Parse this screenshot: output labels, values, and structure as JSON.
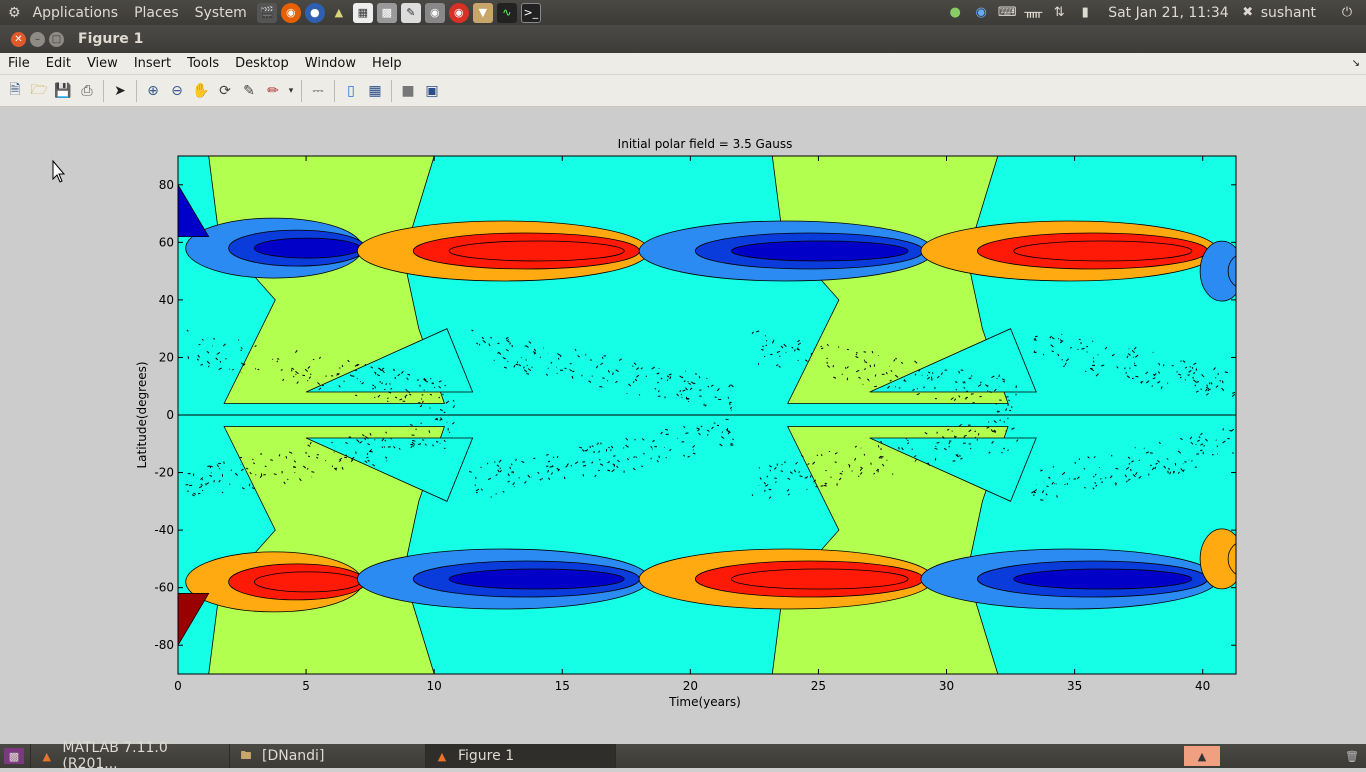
{
  "top_panel": {
    "menus": [
      "Applications",
      "Places",
      "System"
    ],
    "clock": "Sat Jan 21, 11:34",
    "user": "sushant"
  },
  "window": {
    "title": "Figure 1"
  },
  "menubar": {
    "items": [
      "File",
      "Edit",
      "View",
      "Insert",
      "Tools",
      "Desktop",
      "Window",
      "Help"
    ]
  },
  "taskbar": {
    "tasks": [
      {
        "label": "MATLAB  7.11.0 (R201..."
      },
      {
        "label": "[DNandi]"
      },
      {
        "label": "Figure 1"
      }
    ]
  },
  "chart_data": {
    "type": "heatmap",
    "title": "Initial polar field = 3.5 Gauss",
    "xlabel": "Time(years)",
    "ylabel": "Latitude(degrees)",
    "xlim": [
      0,
      41.3
    ],
    "ylim": [
      -90,
      90
    ],
    "xticks": [
      0,
      5,
      10,
      15,
      20,
      25,
      30,
      35,
      40
    ],
    "yticks": [
      -80,
      -60,
      -40,
      -20,
      0,
      20,
      40,
      60,
      80
    ],
    "grid": false,
    "colors": {
      "dark_blue": "#0000c8",
      "blue": "#0a3cdc",
      "light_blue": "#2b8bf2",
      "cyan": "#14ffe6",
      "yellow_green": "#b2ff50",
      "orange": "#ffaa10",
      "red": "#ff1a08",
      "dark_red": "#9a0000"
    },
    "cycle_period_years": 11,
    "polar_bands": [
      {
        "t_start": 0,
        "t_end": 6.9,
        "lat": 58,
        "north": "dark_blue",
        "south": "red"
      },
      {
        "t_start": 6.7,
        "t_end": 18.1,
        "lat": 57,
        "north": "red",
        "south": "dark_blue"
      },
      {
        "t_start": 17.7,
        "t_end": 29.2,
        "lat": 57,
        "north": "dark_blue",
        "south": "red"
      },
      {
        "t_start": 28.7,
        "t_end": 40.3,
        "lat": 57,
        "north": "red",
        "south": "dark_blue"
      },
      {
        "t_start": 39.6,
        "t_end": 41.3,
        "lat": 50,
        "north": "light_blue",
        "south": "orange"
      }
    ]
  }
}
